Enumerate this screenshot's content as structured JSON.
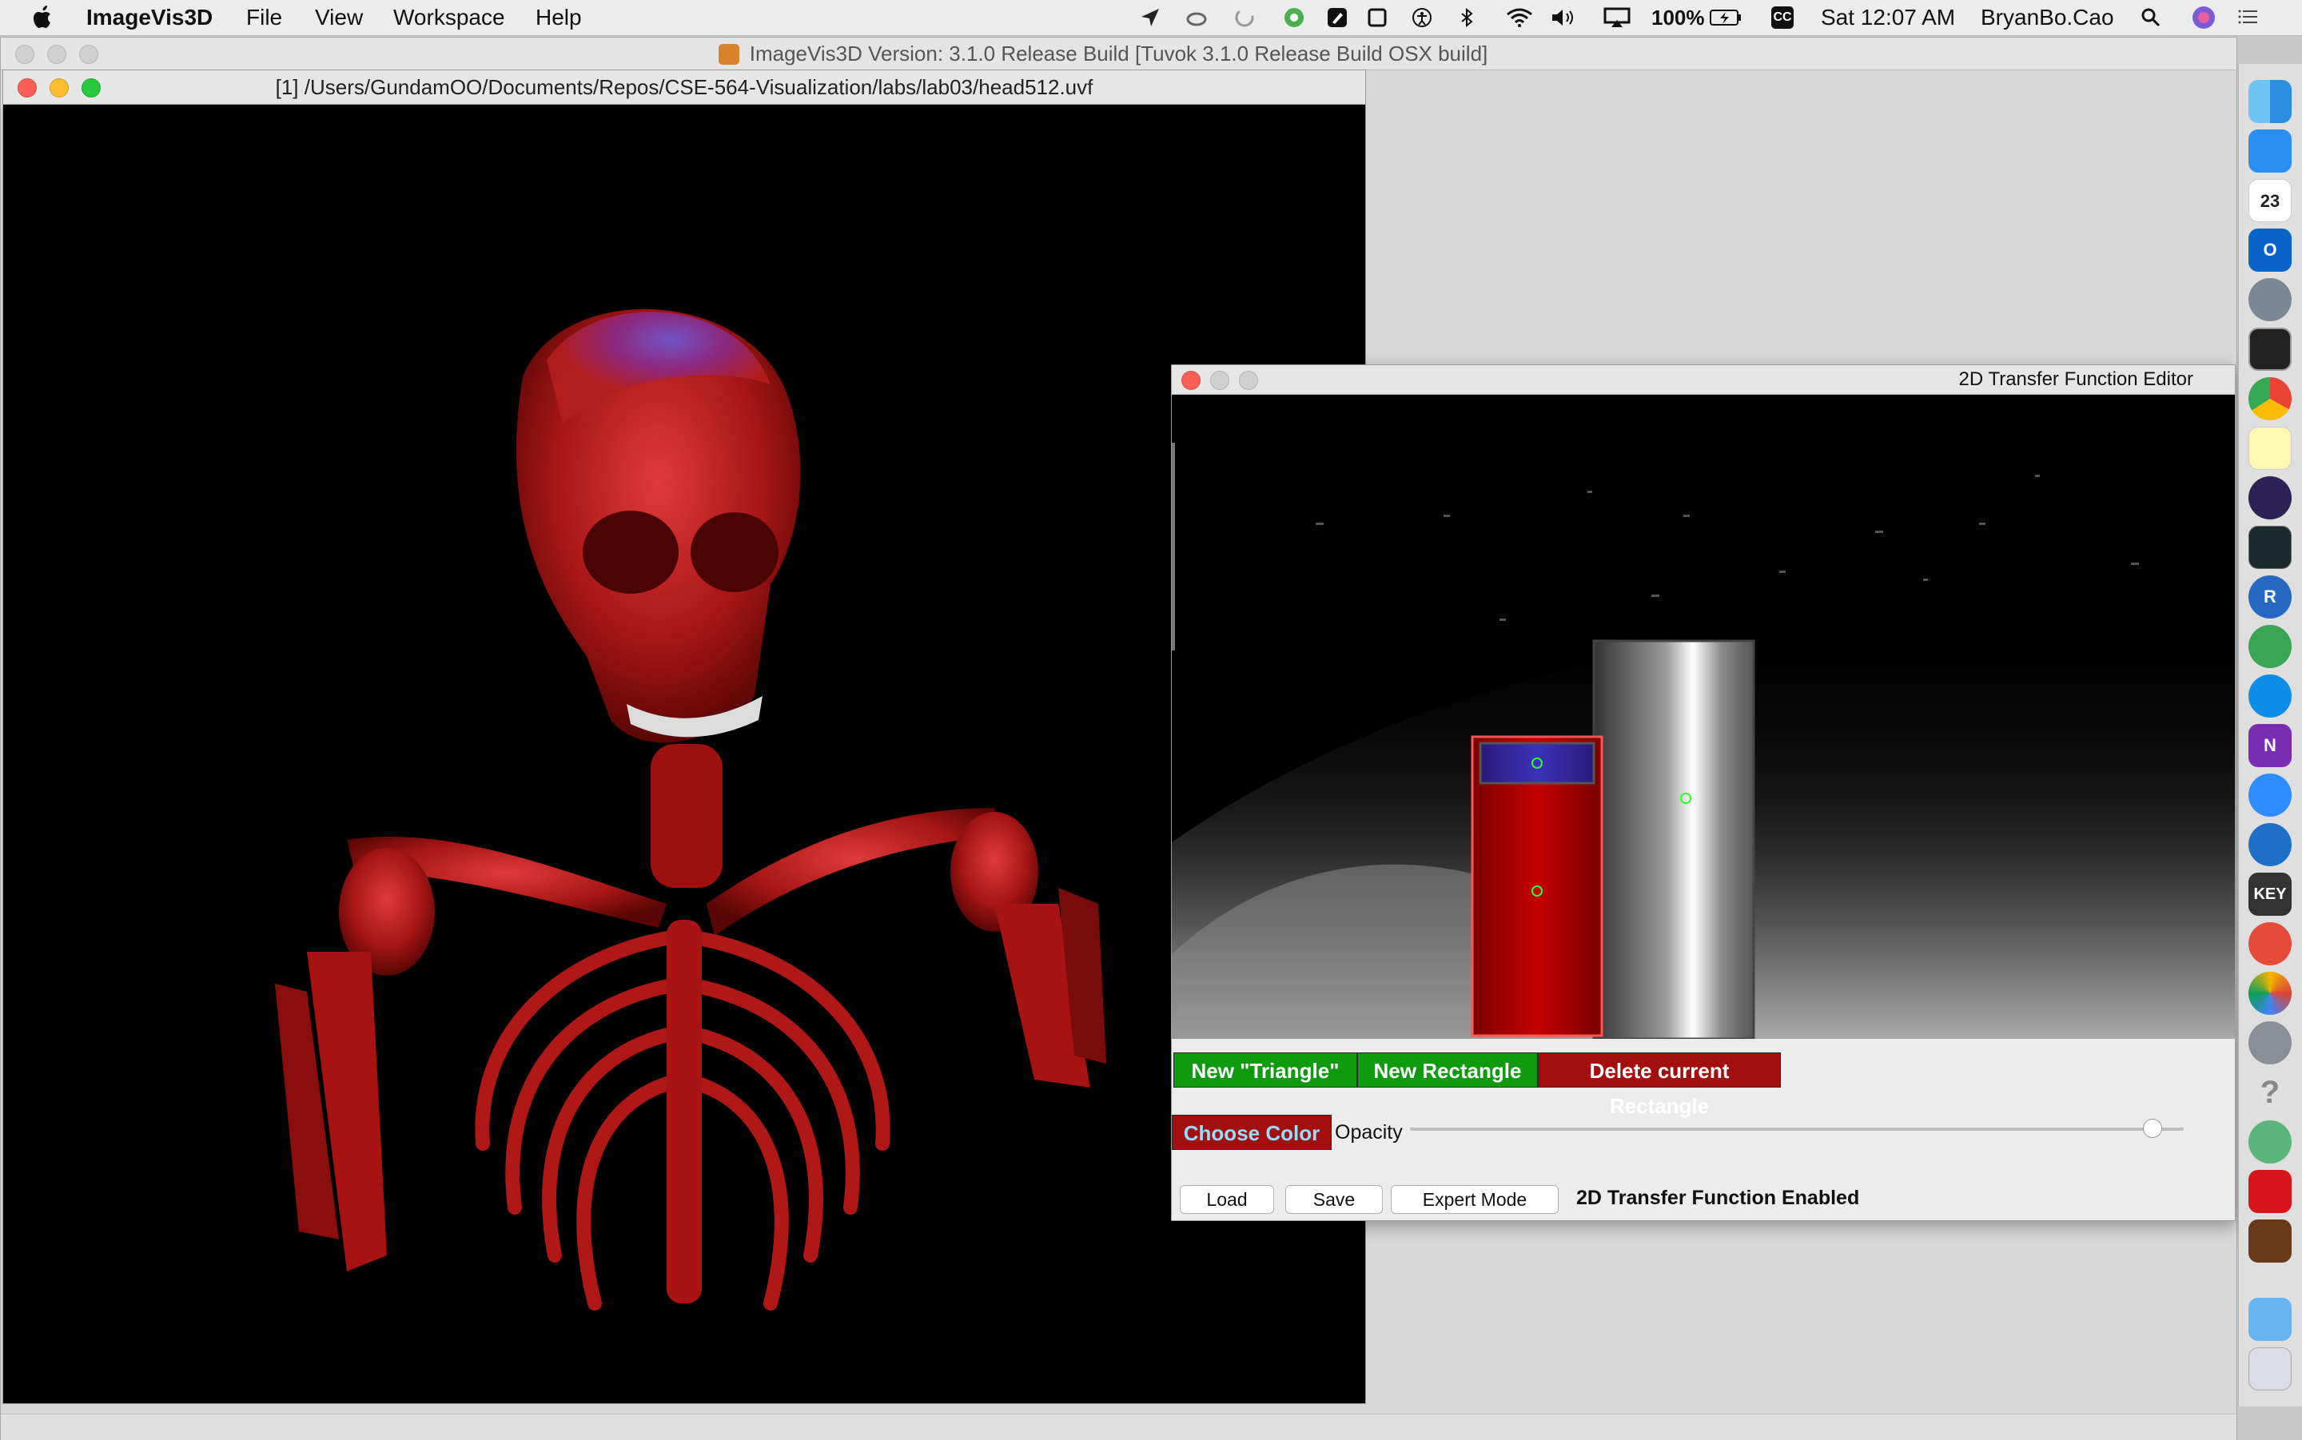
{
  "menubar": {
    "app_name": "ImageVis3D",
    "items": [
      "File",
      "View",
      "Workspace",
      "Help"
    ],
    "battery": "100%",
    "clock": "Sat 12:07 AM",
    "user": "BryanBo.Cao",
    "cc_badge": "CC",
    "icons": [
      "apple-logo-icon",
      "location-arrow-icon",
      "creative-cloud-icon",
      "sync-icon",
      "chrome-status-icon",
      "pen-icon",
      "window-icon",
      "accessibility-icon",
      "bluetooth-icon",
      "wifi-icon",
      "volume-icon",
      "airplay-icon",
      "battery-icon",
      "spotlight-search-icon",
      "siri-icon",
      "notification-list-icon"
    ]
  },
  "app_window": {
    "title": "ImageVis3D Version: 3.1.0 Release Build [Tuvok 3.1.0 Release Build OSX build]",
    "title_icon": "iv3d-badge"
  },
  "render_view": {
    "title": "[1] /Users/GundamOO/Documents/Repos/CSE-564-Visualization/labs/lab03/head512.uvf",
    "content": "volume-rendered-skeleton"
  },
  "tf_editor": {
    "title": "2D Transfer Function Editor",
    "buttons": {
      "new_triangle": "New \"Triangle\"",
      "new_rectangle": "New Rectangle",
      "delete_rectangle": "Delete current Rectangle",
      "choose_color": "Choose Color",
      "load": "Load",
      "save": "Save",
      "expert_mode": "Expert Mode"
    },
    "opacity_label": "Opacity",
    "opacity_value": 0.96,
    "status": "2D Transfer Function Enabled",
    "colors": {
      "green_button": "#109a10",
      "red_button": "#a30f0f",
      "rect_red": "#b30000",
      "rect_blue": "#3a2fa8"
    }
  },
  "dock": {
    "calendar_day": "23",
    "icons": [
      "finder-icon",
      "ink-icon",
      "calendar-icon",
      "outlook-icon",
      "launchpad-icon",
      "terminal-icon",
      "chrome-icon",
      "notes-icon",
      "eclipse-icon",
      "activity-monitor-icon",
      "r-icon",
      "cross-app-icon",
      "teamviewer-icon",
      "onenote-icon",
      "zoom-icon",
      "edge-icon",
      "keynote-icon",
      "creative-cloud-icon",
      "photos-icon",
      "system-preferences-icon",
      "help-icon",
      "atom-icon",
      "acrobat-icon",
      "imagevis3d-icon",
      "folder-icon",
      "trash-icon"
    ],
    "labels": {
      "onenote": "N",
      "keynote": "KEY",
      "r": "R",
      "outlook": "O"
    }
  }
}
